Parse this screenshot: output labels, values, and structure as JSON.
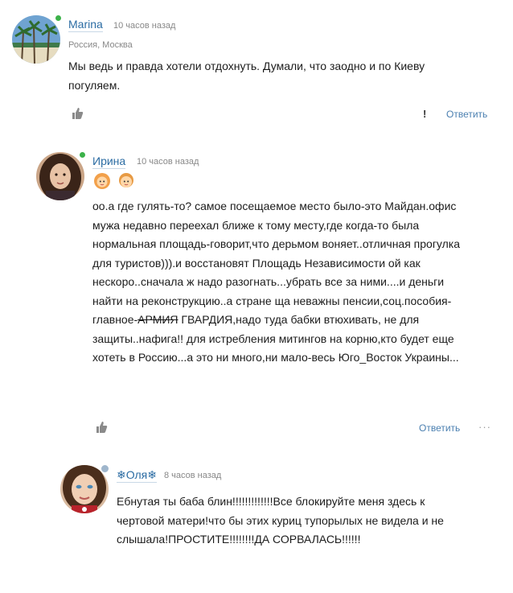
{
  "comments": [
    {
      "author": "Marina",
      "time": "10 часов назад",
      "location": "Россия, Москва",
      "lines": [
        "Мы ведь и правда хотели отдохнуть. Думали, что заодно и по Киеву",
        "погуляем."
      ],
      "report": "!",
      "reply": "Ответить"
    },
    {
      "author": "Ирина",
      "time": "10 часов назад",
      "badges": [
        "girl-badge-icon",
        "boy-badge-icon"
      ],
      "lines": [
        "оо.а где гулять-то? самое посещаемое место было-это Майдан.офис",
        "мужа недавно переехал ближе к тому месту,где когда-то была",
        "нормальная площадь-говорит,что дерьмом воняет..отличная прогулка",
        "для туристов))).и восстановят Площадь Независимости ой как",
        "нескоро..сначала ж надо разогнать...убрать все за ними....и деньги",
        "найти на реконструкцию..а стране ща неважны пенсии,соц.пособия-"
      ],
      "line7_before": "главное-",
      "line7_strike": "АРМИЯ",
      "line7_after": " ГВАРДИЯ,надо туда бабки втюхивать, не для",
      "lines_tail": [
        "защиты..нафига!! для истребления митингов на корню,кто будет еще",
        "хотеть в Россию...а это ни много,ни мало-весь Юго_Восток Украины..."
      ],
      "reply": "Ответить",
      "more": "···"
    },
    {
      "author": "❄Оля❄",
      "time": "8 часов назад",
      "lines": [
        "Ебнутая ты баба блин!!!!!!!!!!!!!Все блокируйте меня здесь к",
        "чертовой матери!что бы этих куриц тупорылых не видела и не",
        "слышала!ПРОСТИТЕ!!!!!!!!ДА СОРВАЛАСЬ!!!!!!"
      ]
    }
  ]
}
